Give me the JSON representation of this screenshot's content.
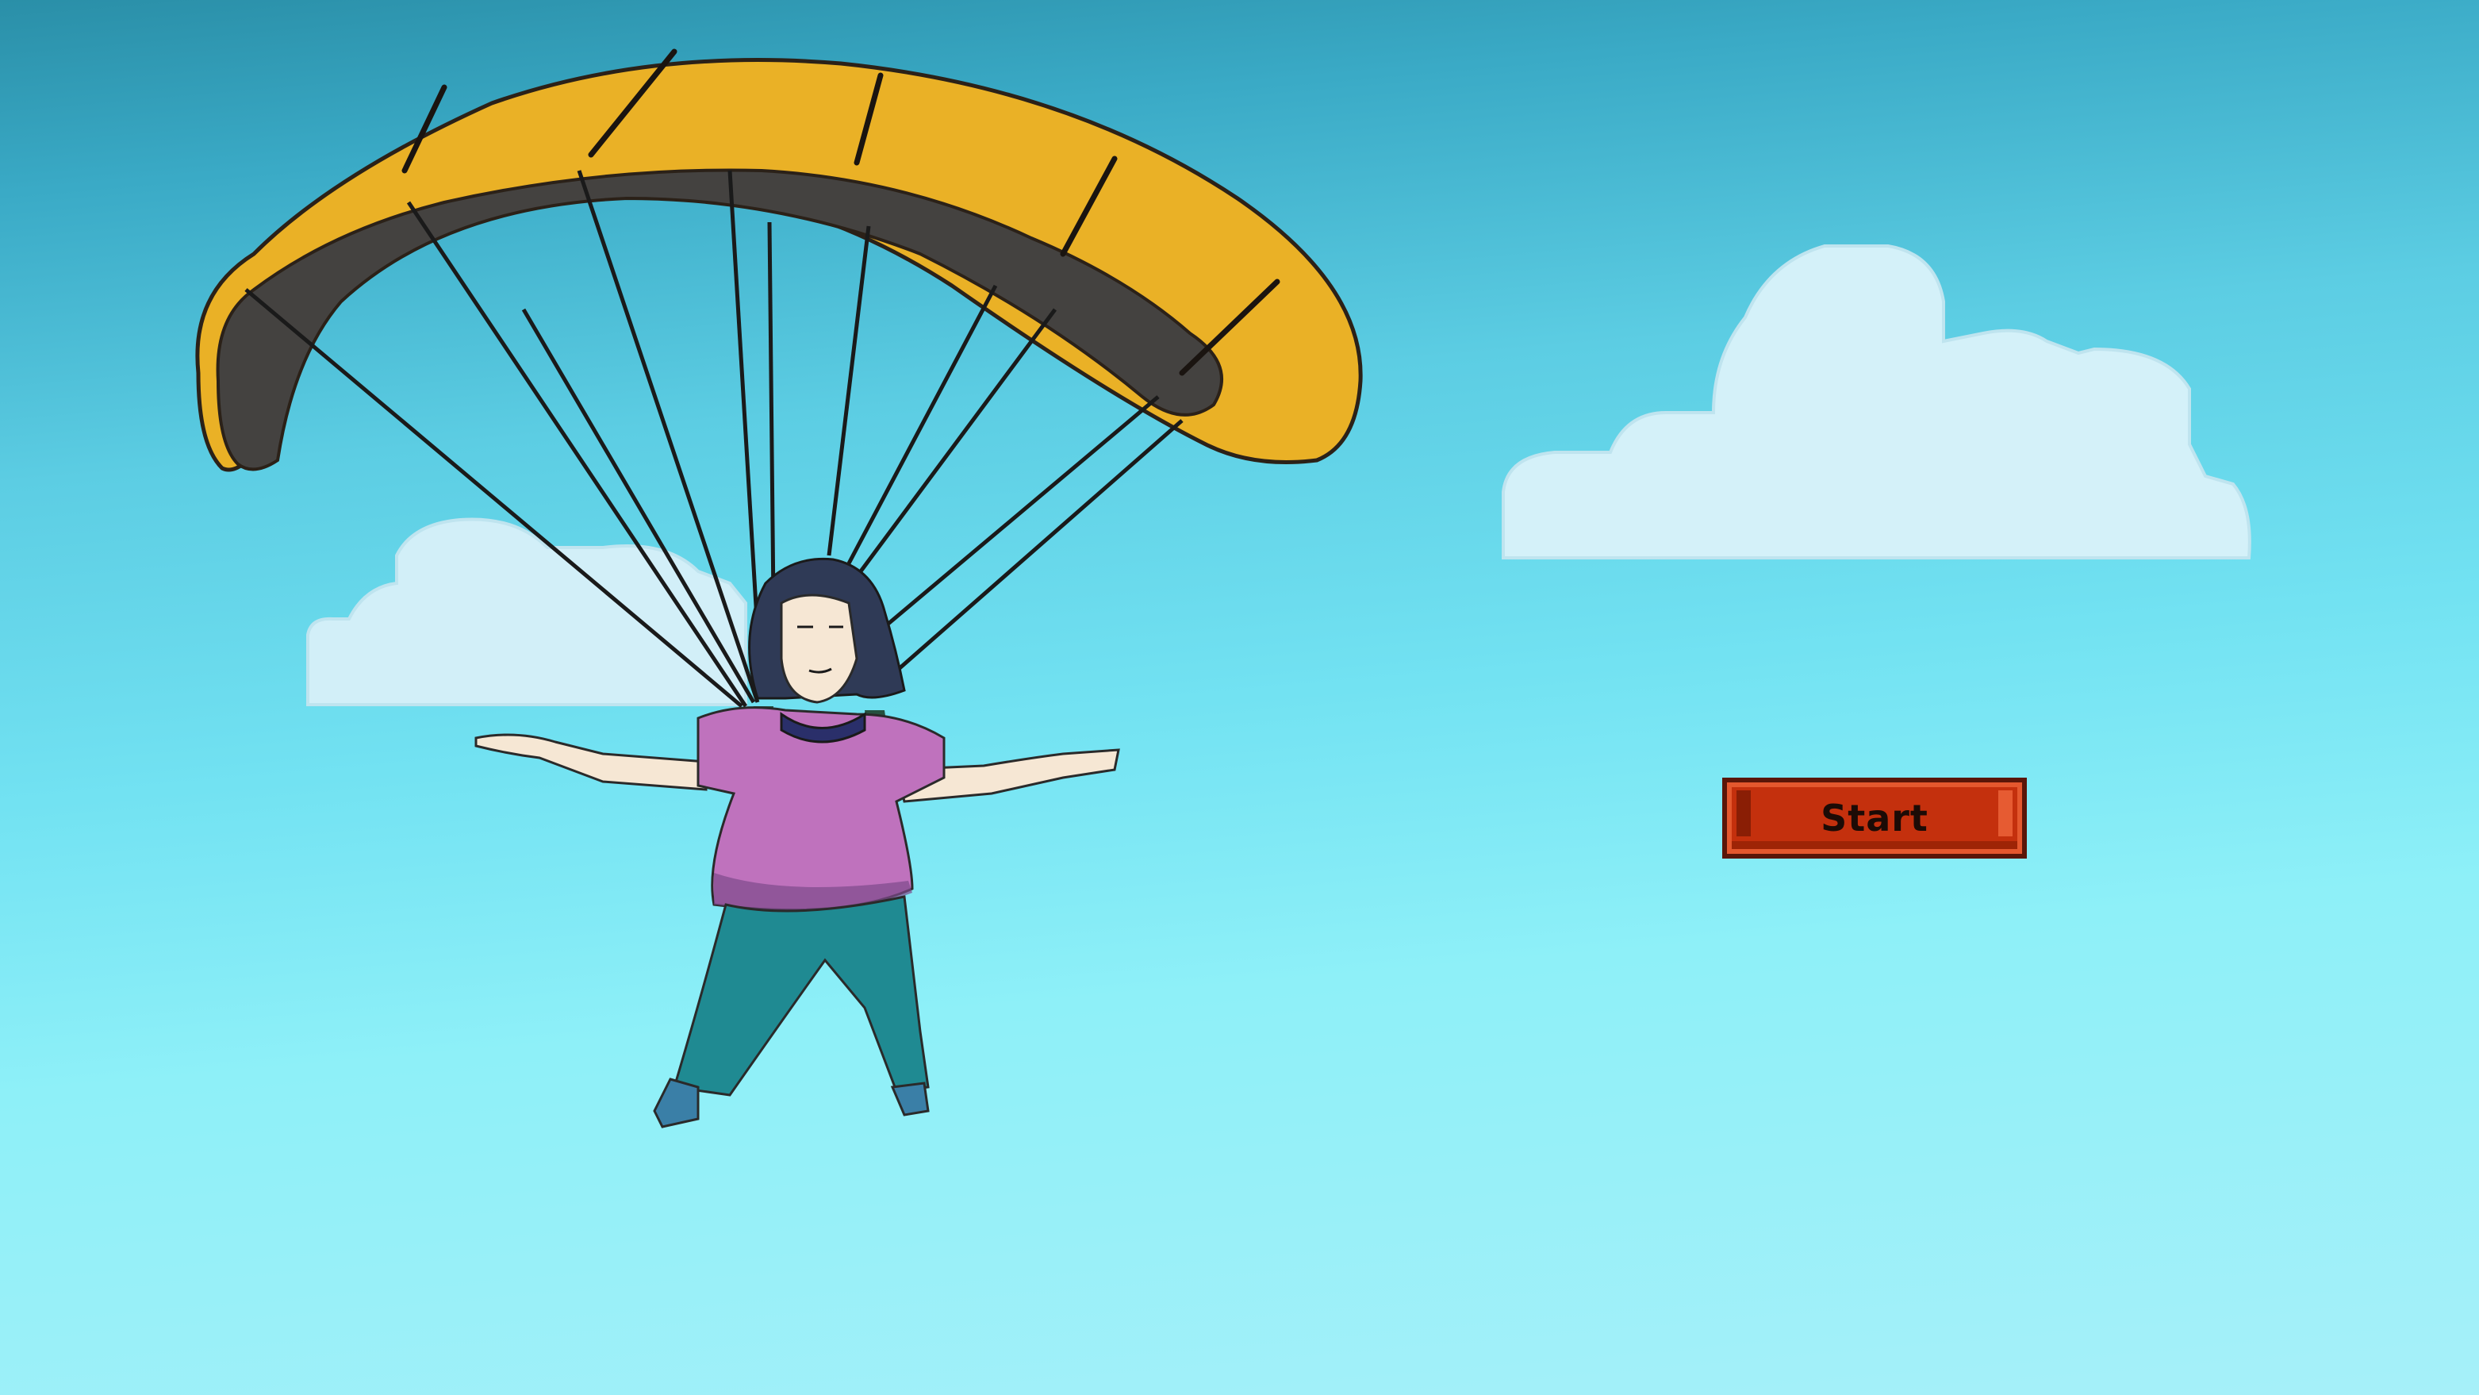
{
  "start_button": {
    "label": "Start"
  },
  "scene": {
    "character": "paraglider-girl",
    "colors": {
      "sky_top": "#2a8fa8",
      "sky_bottom": "#a6f0f9",
      "canopy": "#eab126",
      "canopy_underside": "#444240",
      "shirt": "#bf72bd",
      "pants": "#1f8a92",
      "button": "#c4300d"
    }
  }
}
